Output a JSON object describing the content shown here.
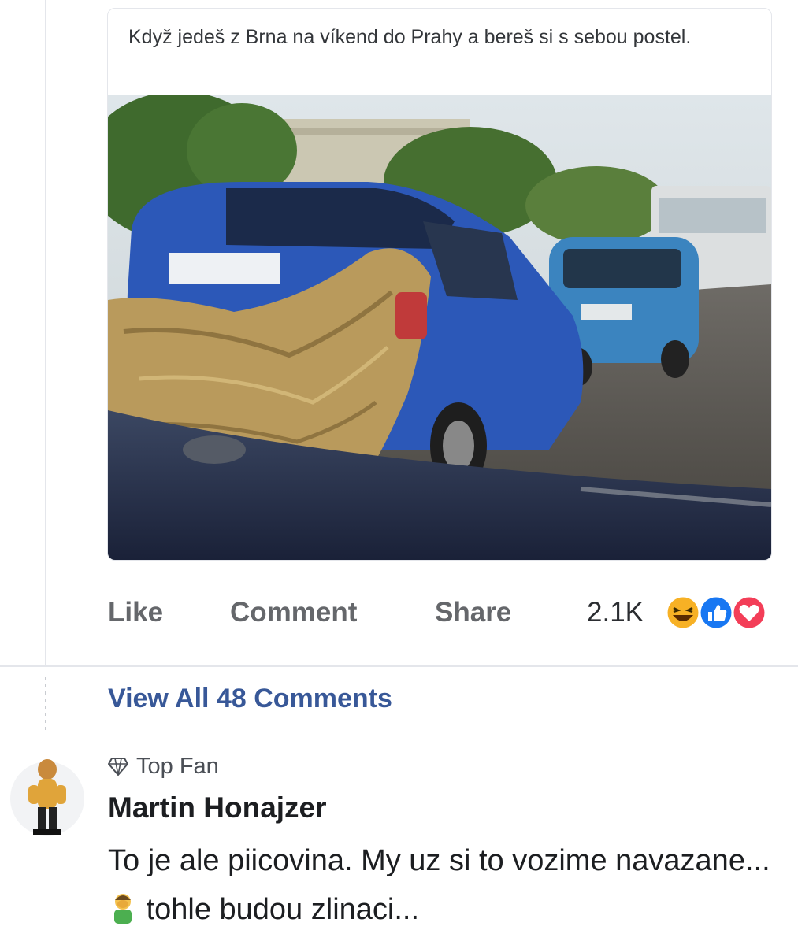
{
  "post": {
    "text": "Když jedeš z Brna na víkend do Prahy a bereš si s sebou postel."
  },
  "actions": {
    "like_label": "Like",
    "comment_label": "Comment",
    "share_label": "Share",
    "reaction_count": "2.1K",
    "reaction_icons": [
      "haha-reaction-icon",
      "like-reaction-icon",
      "love-reaction-icon"
    ]
  },
  "comments": {
    "view_all_label": "View All 48 Comments",
    "items": [
      {
        "badge": "Top Fan",
        "author": "Martin Honajzer",
        "text_part1": "To je ale piicovina. My uz si to vozime navazane...",
        "text_part2": "tohle budou zlinaci..."
      }
    ]
  },
  "colors": {
    "link_blue": "#385898",
    "action_gray": "#65676b",
    "like_blue": "#1877f2",
    "love_red": "#f33e58",
    "haha_yellow": "#f7b125"
  }
}
